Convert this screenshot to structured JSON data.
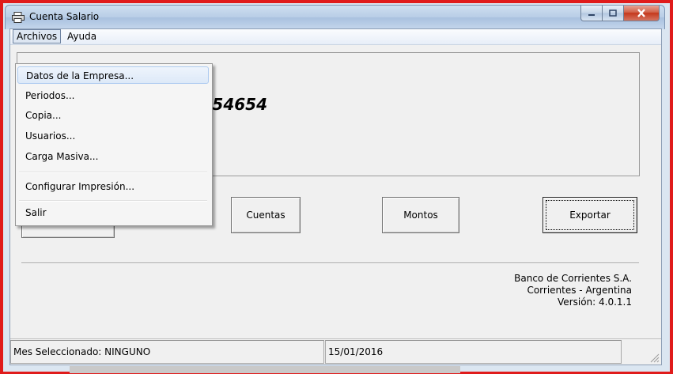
{
  "window": {
    "title": "Cuenta Salario",
    "controls": {
      "minimize": "minimize-icon",
      "maximize": "maximize-icon",
      "close": "close-icon"
    }
  },
  "menubar": {
    "items": [
      {
        "label": "Archivos"
      },
      {
        "label": "Ayuda"
      }
    ]
  },
  "dropdown": {
    "items": [
      {
        "label": "Datos de la Empresa..."
      },
      {
        "label": "Periodos..."
      },
      {
        "label": "Copia..."
      },
      {
        "label": "Usuarios..."
      },
      {
        "label": "Carga Masiva..."
      },
      {
        "label": "Configurar Impresión..."
      },
      {
        "label": "Salir"
      }
    ]
  },
  "panel": {
    "partial_number": "54654"
  },
  "buttons": {
    "cuentas": "Cuentas",
    "montos": "Montos",
    "exportar": "Exportar"
  },
  "bank_info": {
    "line1": "Banco de Corrientes S.A.",
    "line2": "Corrientes - Argentina",
    "line3": "Versión: 4.0.1.1"
  },
  "statusbar": {
    "mes": "Mes Seleccionado: NINGUNO",
    "date": "15/01/2016"
  },
  "colors": {
    "frame_border": "#e01b1b",
    "close_button": "#c5381c",
    "menu_highlight": "#dde9f8"
  }
}
